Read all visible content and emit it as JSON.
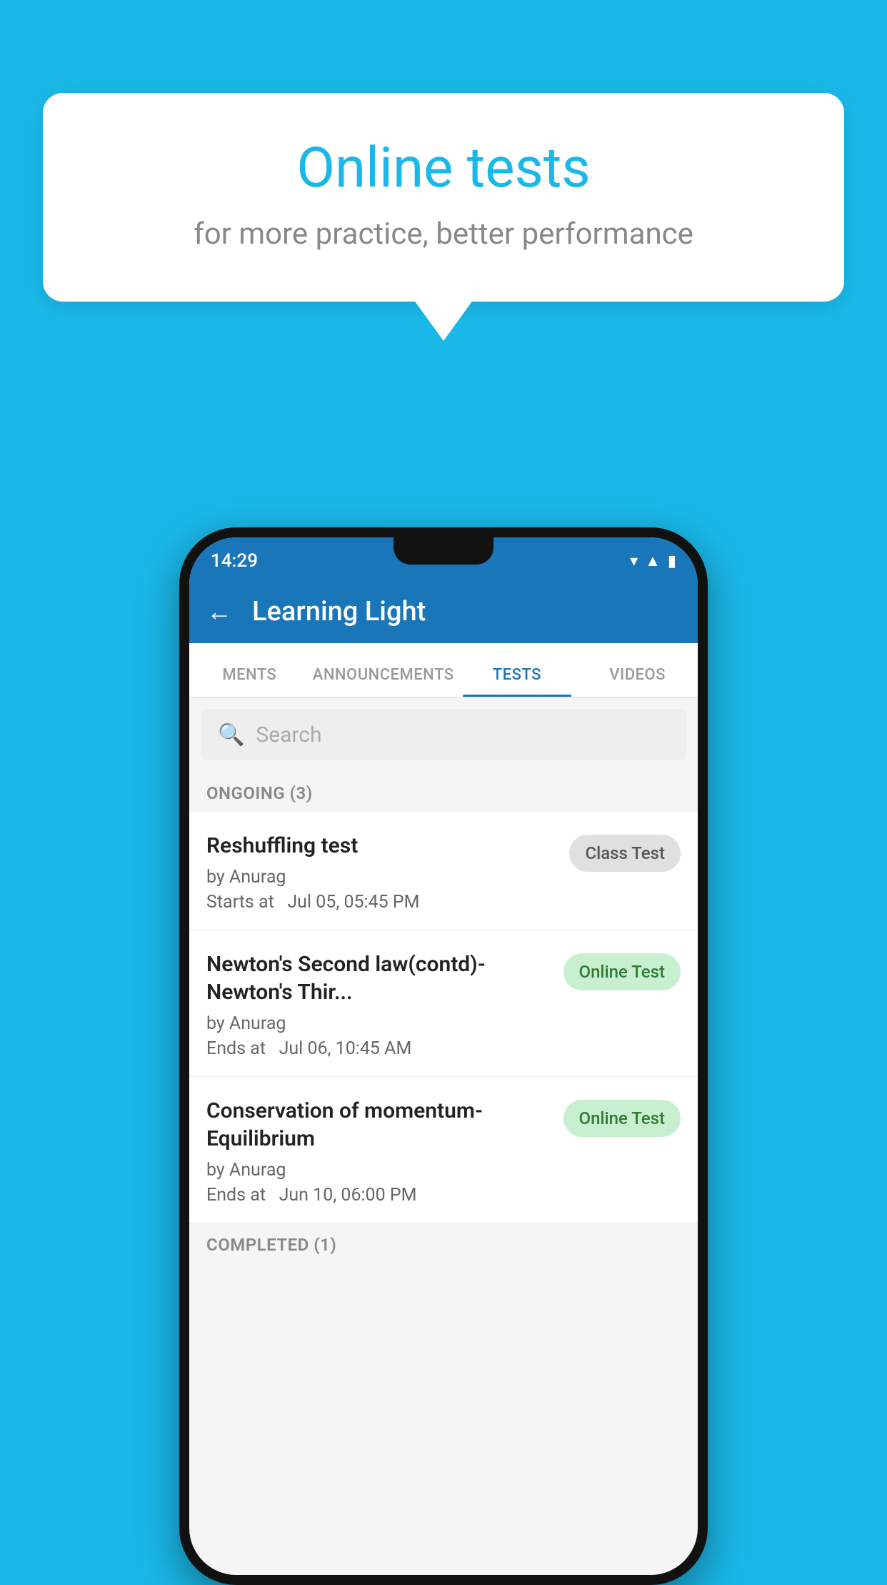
{
  "background": {
    "color": "#1ab8e8"
  },
  "speech_bubble": {
    "title": "Online tests",
    "subtitle": "for more practice, better performance"
  },
  "phone": {
    "status_bar": {
      "time": "14:29",
      "wifi": "▾",
      "signal": "▲",
      "battery": "▮"
    },
    "app_bar": {
      "back_label": "←",
      "title": "Learning Light"
    },
    "tabs": [
      {
        "label": "MENTS",
        "active": false
      },
      {
        "label": "ANNOUNCEMENTS",
        "active": false
      },
      {
        "label": "TESTS",
        "active": true
      },
      {
        "label": "VIDEOS",
        "active": false
      }
    ],
    "search": {
      "placeholder": "Search"
    },
    "sections": [
      {
        "header": "ONGOING (3)",
        "items": [
          {
            "name": "Reshuffling test",
            "author": "by Anurag",
            "time": "Starts at  Jul 05, 05:45 PM",
            "badge": "Class Test",
            "badge_type": "class"
          },
          {
            "name": "Newton's Second law(contd)-Newton's Thir...",
            "author": "by Anurag",
            "time": "Ends at  Jul 06, 10:45 AM",
            "badge": "Online Test",
            "badge_type": "online"
          },
          {
            "name": "Conservation of momentum-Equilibrium",
            "author": "by Anurag",
            "time": "Ends at  Jun 10, 06:00 PM",
            "badge": "Online Test",
            "badge_type": "online"
          }
        ]
      },
      {
        "header": "COMPLETED (1)",
        "items": []
      }
    ]
  }
}
